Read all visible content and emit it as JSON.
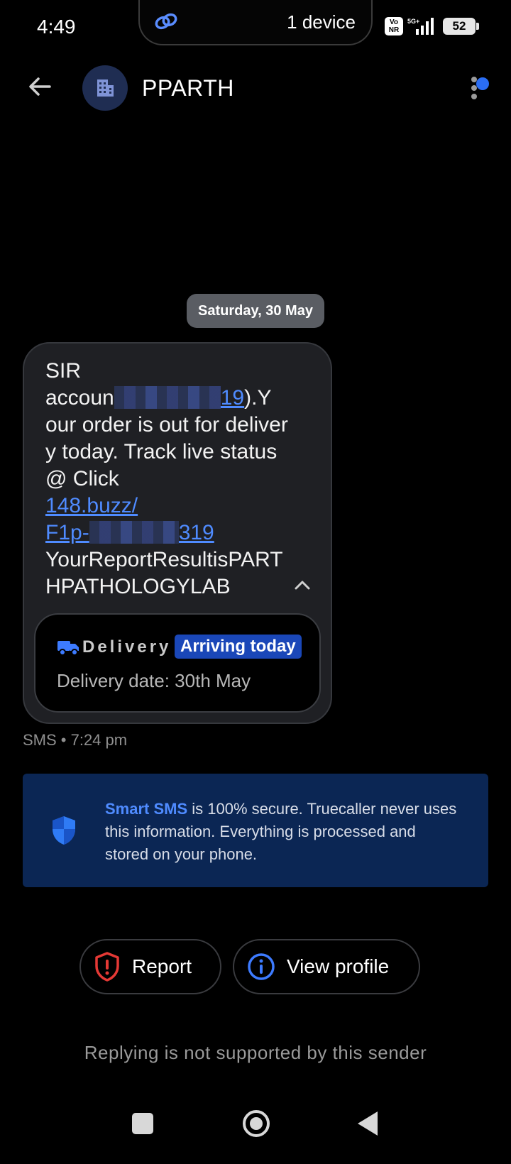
{
  "status_bar": {
    "time": "4:49",
    "device_text": "1 device",
    "volte_text": "Vo NR",
    "network": "5G+",
    "battery": "52"
  },
  "header": {
    "sender": "PPARTH"
  },
  "conversation": {
    "date_chip": "Saturday, 30 May",
    "message": {
      "line1": "SIR",
      "acc_prefix": "accoun",
      "acc_link_tail": "19",
      "acc_after": ").Y",
      "body_text": "our order is out for delivery today. Track live status @ Click",
      "link_part1": "148.buzz/",
      "link_part2_prefix": "F1p-",
      "link_part2_tail": "319",
      "closing_text": "YourReportResultisPARTHPATHOLOGYLAB"
    },
    "delivery_card": {
      "label": "Delivery",
      "badge": "Arriving today",
      "subtitle": "Delivery date: 30th May"
    },
    "meta": "SMS • 7:24 pm"
  },
  "smart_sms_banner": {
    "highlight": "Smart SMS",
    "text": " is 100% secure. Truecaller never uses this information. Everything is processed and stored on your phone."
  },
  "actions": {
    "report_label": "Report",
    "view_profile_label": "View profile"
  },
  "footer": {
    "reply_note": "Replying is not supported by this sender"
  },
  "colors": {
    "accent_blue": "#4f8bff",
    "banner_bg": "#0b2654",
    "report_red": "#e53935"
  }
}
